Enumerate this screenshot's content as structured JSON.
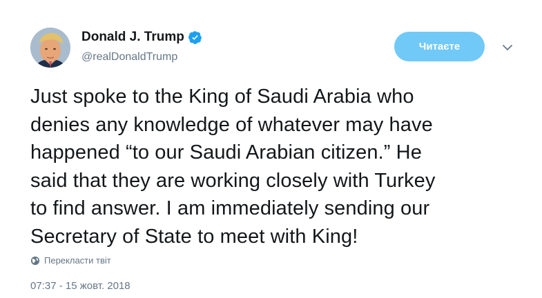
{
  "tweet": {
    "display_name": "Donald J. Trump",
    "handle": "@realDonaldTrump",
    "follow_label": "Читаєте",
    "text": "Just spoke to the King of Saudi Arabia who\ndenies any knowledge of whatever may have\nhappened “to our Saudi Arabian citizen.” He\nsaid that they are working closely with Turkey\nto find answer. I am immediately sending our\nSecretary of State to meet with King!",
    "translate_label": "Перекласти твіт",
    "timestamp": "07:37 - 15 жовт. 2018"
  },
  "colors": {
    "accent": "#71c9f8",
    "verified": "#1da1f2",
    "secondary_text": "#657786",
    "primary_text": "#14171a"
  },
  "icons": {
    "verified": "verified-badge-icon",
    "caret": "chevron-down-icon",
    "translate": "globe-icon"
  }
}
